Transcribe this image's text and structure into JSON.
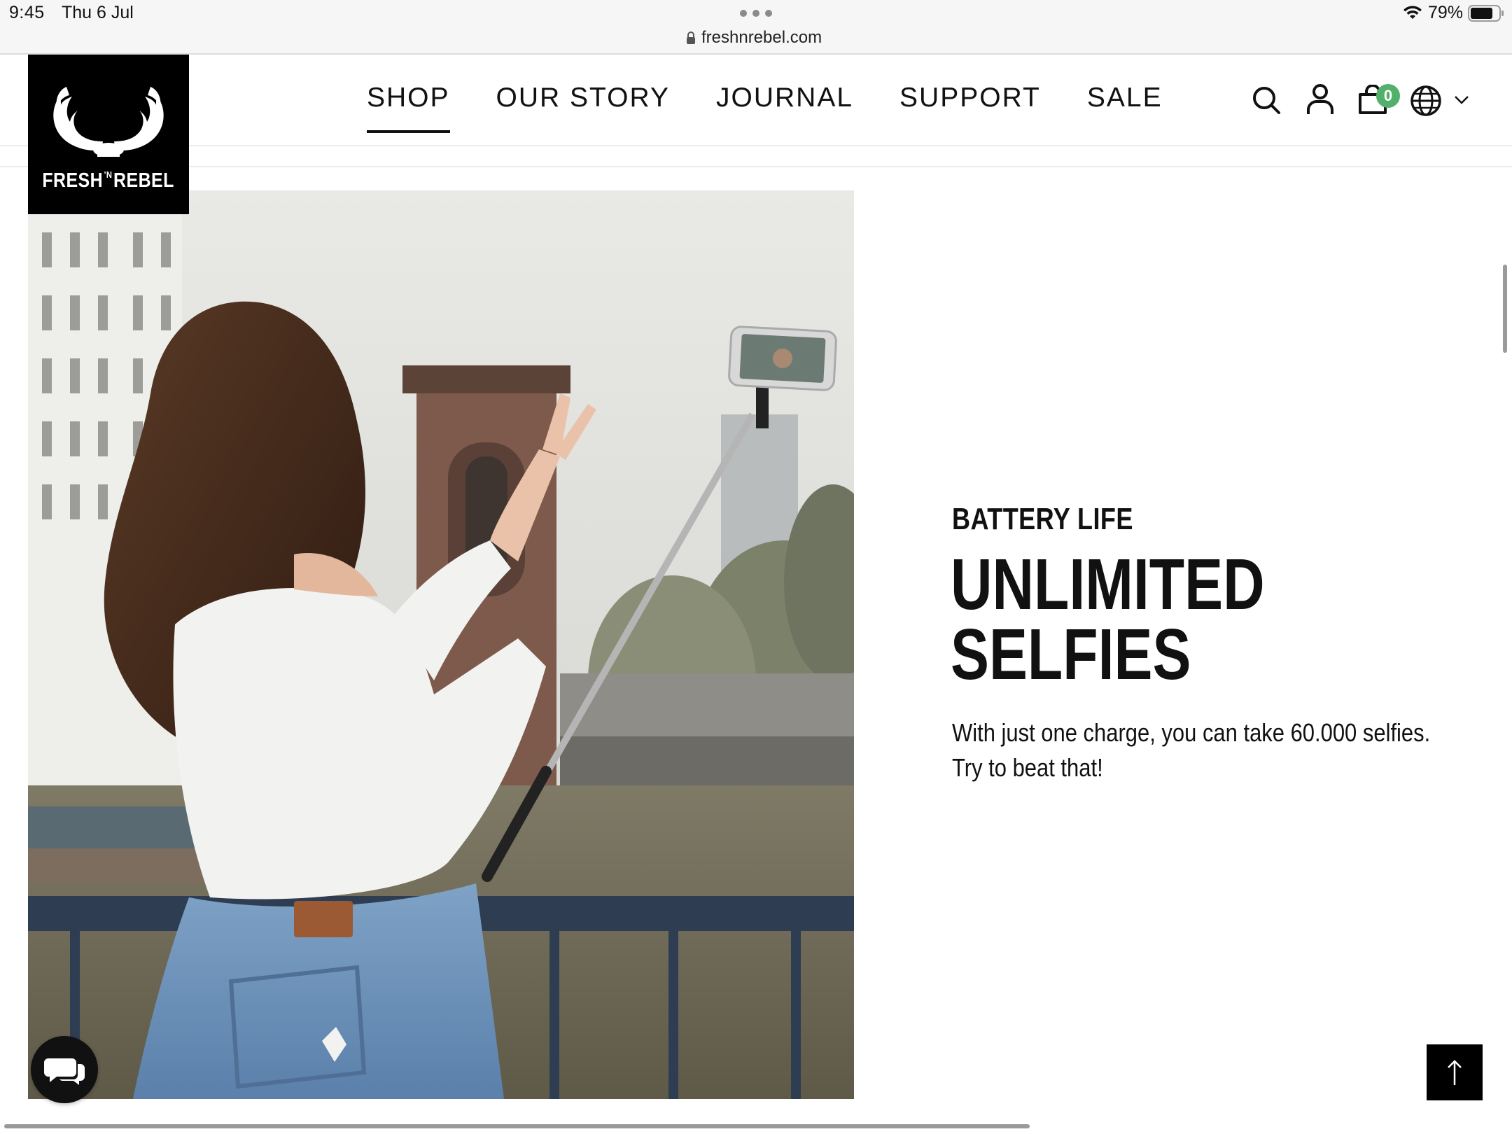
{
  "status_bar": {
    "time": "9:45",
    "date": "Thu 6 Jul",
    "battery_percent": "79%",
    "battery_level": 0.79
  },
  "browser": {
    "url": "freshnrebel.com"
  },
  "header": {
    "logo_text": "FRESH",
    "logo_n": "'N",
    "logo_text2": "REBEL",
    "nav": [
      {
        "label": "SHOP",
        "active": true
      },
      {
        "label": "OUR STORY",
        "active": false
      },
      {
        "label": "JOURNAL",
        "active": false
      },
      {
        "label": "SUPPORT",
        "active": false
      },
      {
        "label": "SALE",
        "active": false
      }
    ],
    "cart_count": "0",
    "icons": [
      "search-icon",
      "user-icon",
      "cart-icon",
      "globe-icon",
      "chevron-down-icon"
    ]
  },
  "feature": {
    "eyebrow": "BATTERY LIFE",
    "headline_line1": "UNLIMITED",
    "headline_line2": "SELFIES",
    "body_line1": "With just one charge, you can take 60.000 selfies.",
    "body_line2": "Try to beat that!"
  },
  "floating": {
    "chat_icon": "chat-bubbles-icon",
    "back_to_top_icon": "arrow-up-icon"
  },
  "colors": {
    "accent_badge": "#52b06b",
    "text": "#111111",
    "logo_bg": "#000000"
  }
}
